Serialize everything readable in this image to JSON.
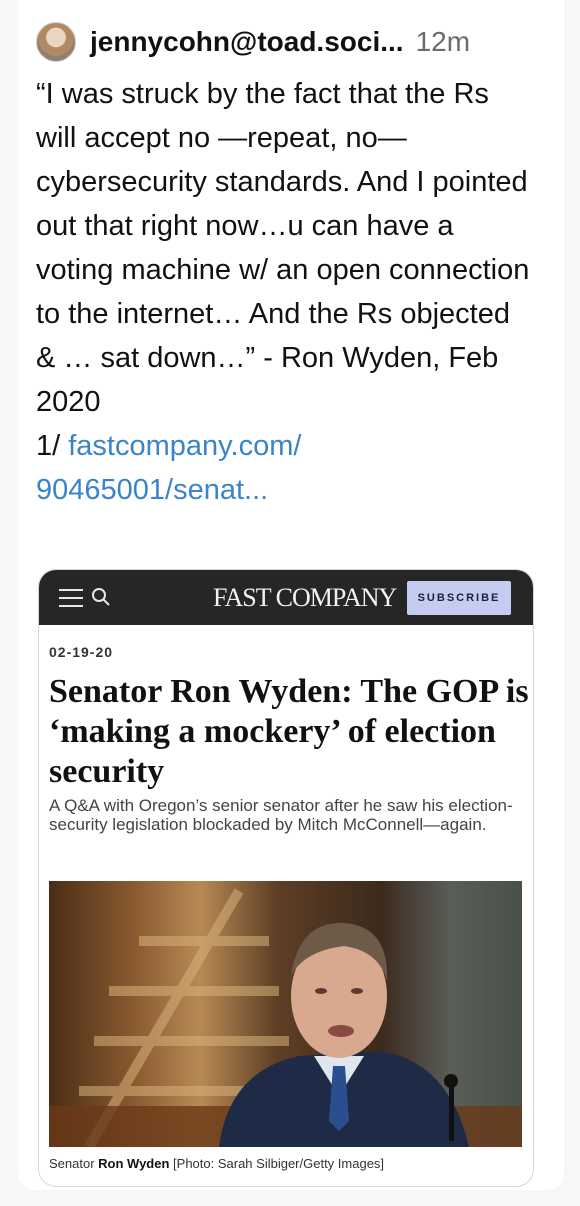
{
  "post": {
    "handle": "jennycohn@toad.soci...",
    "time": "12m",
    "text": "“I was struck by the fact that the Rs will accept no —repeat, no— cybersecurity standards. And I pointed out that right now…u can have a voting machine w/ an open connection to the internet… And the Rs objected & … sat down…” - Ron Wyden, Feb 2020",
    "link_prefix": "1/ ",
    "link_text": "fastcompany.com/ 90465001/senat..."
  },
  "article": {
    "logo": "FAST COMPANY",
    "subscribe_label": "SUBSCRIBE",
    "date": "02-19-20",
    "headline": "Senator Ron Wyden: The GOP is ‘making a mockery’ of election security",
    "dek": "A Q&A with Oregon’s senior senator after he saw his election-security legislation blockaded by Mitch McConnell—again.",
    "caption_prefix": "Senator ",
    "caption_name": "Ron Wyden",
    "caption_credit": " [Photo: Sarah Silbiger/Getty Images]"
  },
  "icons": {
    "avatar": "avatar",
    "menu": "menu-icon",
    "search": "search-icon"
  },
  "colors": {
    "link": "#3a84c9",
    "navbar": "#262626",
    "subscribe_bg": "#c4ccf1"
  }
}
